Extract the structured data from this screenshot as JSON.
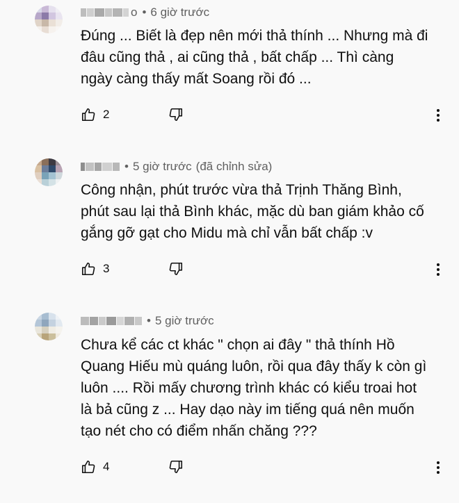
{
  "comments": [
    {
      "author_suffix": "o",
      "time": "6 giờ trước",
      "edited": "",
      "lines": [
        "Đúng ... Biết là đẹp nên mới thả thính ... Nhưng mà đi",
        "đâu cũng thả , ai cũng thả , bất chấp ... Thì càng",
        "ngày càng thấy mất Soang rồi đó ..."
      ],
      "likes": "2"
    },
    {
      "author_suffix": "",
      "time": "5 giờ trước",
      "edited": "(đã chỉnh sửa)",
      "lines": [
        "Công nhận, phút trước vừa thả Trịnh Thăng Bình,",
        "phút sau lại thả Bình khác, mặc dù ban giám khảo cố",
        "gắng gỡ gạt cho Midu mà chỉ vẫn bất chấp :v"
      ],
      "likes": "3"
    },
    {
      "author_suffix": "",
      "time": "5 giờ trước",
      "edited": "",
      "lines": [
        "Chưa kể các ct khác \" chọn ai đây \" thả thính Hồ",
        "Quang Hiếu mù quáng luôn, rồi qua đây thấy k còn gì",
        "luôn .... Rồi mấy chương trình khác có kiểu troai hot",
        "là bả cũng z ... Hay dạo này im tiếng quá nên muốn",
        "tạo nét cho có điểm nhấn chăng ???"
      ],
      "likes": "4"
    }
  ],
  "icons": {
    "like": "thumbs-up-icon",
    "dislike": "thumbs-down-icon",
    "more": "more-vertical-icon"
  }
}
